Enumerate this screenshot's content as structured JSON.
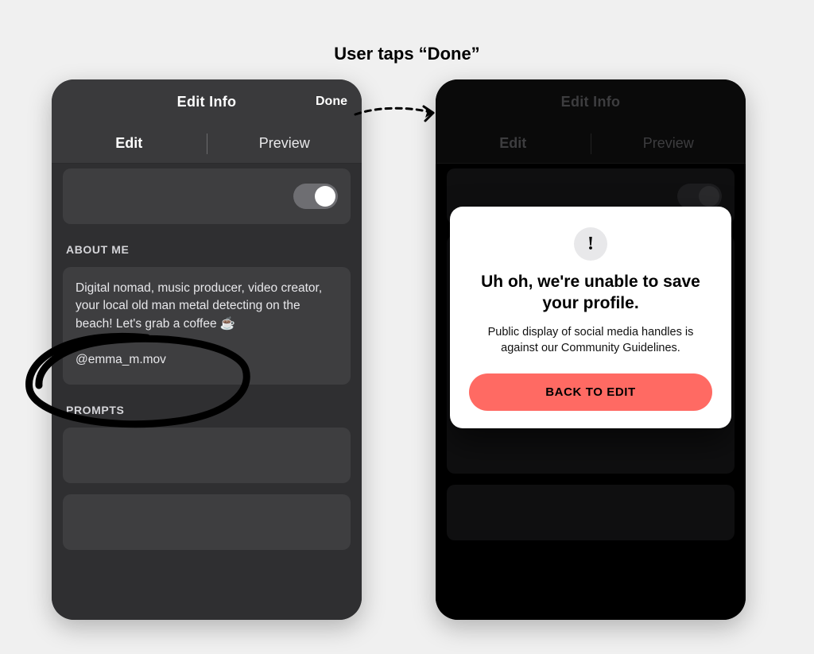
{
  "caption": "User taps “Done”",
  "left_screen": {
    "nav_title": "Edit  Info",
    "done_label": "Done",
    "tabs": {
      "edit": "Edit",
      "preview": "Preview"
    },
    "about_label": "ABOUT ME",
    "about_text": "Digital nomad, music producer, video creator, your local old man metal detecting on the beach! Let's grab a coffee ☕\n\n@emma_m.mov",
    "prompts_label": "PROMPTS"
  },
  "right_screen": {
    "nav_title": "Edit  Info",
    "tabs": {
      "edit": "Edit",
      "preview": "Preview"
    }
  },
  "modal": {
    "alert_glyph": "!",
    "title": "Uh oh, we're unable to save your profile.",
    "body": "Public display of social media handles is against our Community Guidelines.",
    "cta": "BACK TO EDIT"
  }
}
